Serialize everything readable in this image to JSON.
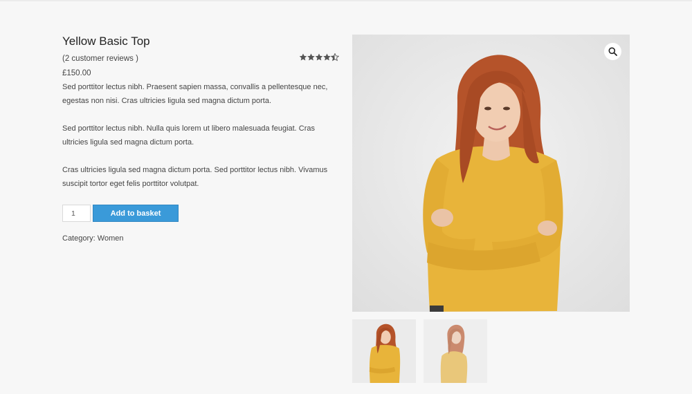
{
  "product": {
    "title": "Yellow Basic Top",
    "reviews_text": "(2 customer reviews )",
    "rating": 4.5,
    "rating_max": 5,
    "price": "£150.00",
    "description": [
      "Sed porttitor lectus nibh. Praesent sapien massa, convallis a pellentesque nec, egestas non nisi. Cras ultricies ligula sed magna dictum porta.",
      "Sed porttitor lectus nibh. Nulla quis lorem ut libero malesuada feugiat. Cras ultricies ligula sed magna dictum porta.",
      "Cras ultricies ligula sed magna dictum porta. Sed porttitor lectus nibh. Vivamus suscipit tortor eget felis porttitor volutpat."
    ],
    "quantity": "1",
    "add_to_basket_label": "Add to basket",
    "category_label": "Category:",
    "category_value": "Women"
  },
  "gallery": {
    "zoom_icon": "magnifier-icon",
    "thumbnails": [
      "product-thumbnail-front",
      "product-thumbnail-side"
    ]
  },
  "colors": {
    "button": "#3a9ad9",
    "stars": "#555555",
    "shirt": "#e8b43a",
    "hair": "#b5532a"
  }
}
